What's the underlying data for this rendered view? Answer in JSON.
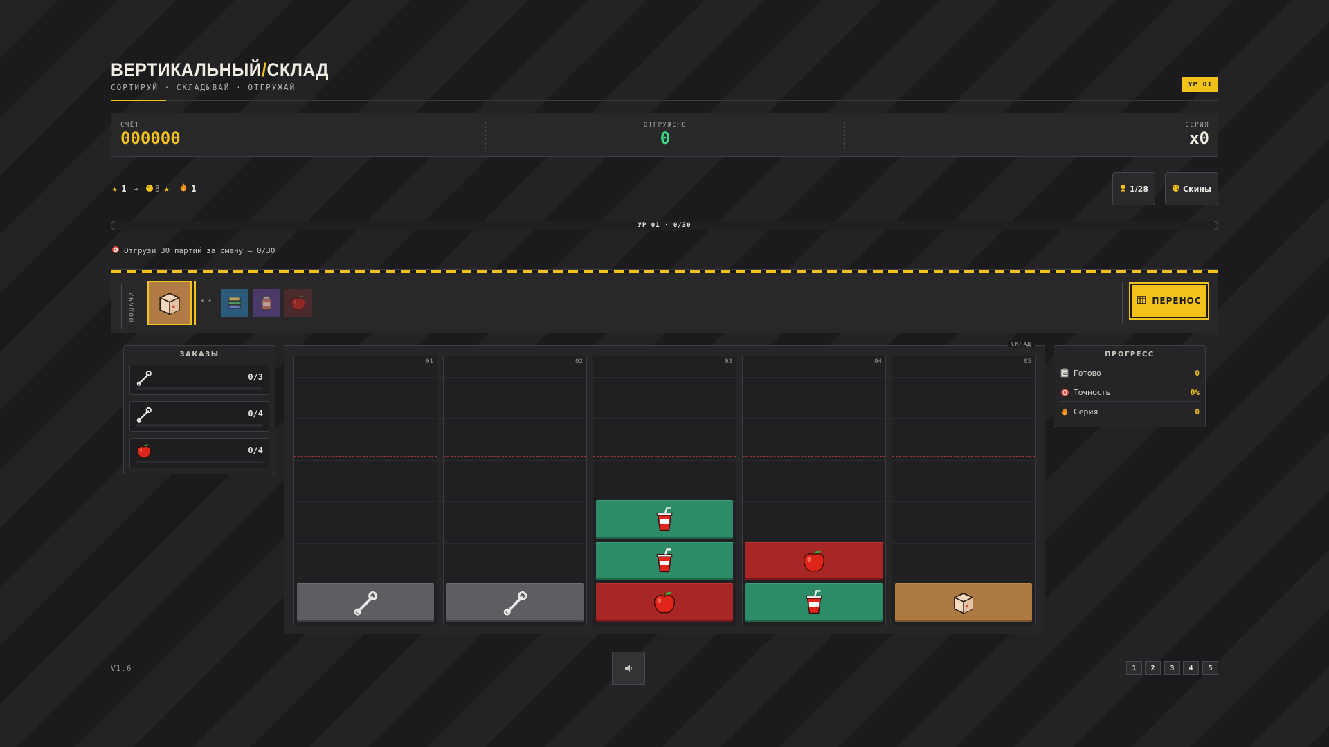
{
  "header": {
    "title_left": "ВЕРТИКАЛЬНЫЙ",
    "title_slash": "/",
    "title_right": "СКЛАД",
    "subtitle": "СОРТИРУЙ · СКЛАДЫВАЙ · ОТГРУЖАЙ",
    "level_badge": "УР 01"
  },
  "stats": {
    "score_label": "СЧЁТ",
    "score_value": "000000",
    "shipped_label": "ОТГРУЖЕНО",
    "shipped_value": "0",
    "streak_label": "СЕРИЯ",
    "streak_value": "x0"
  },
  "resources": {
    "stars": "1",
    "arrow": "→",
    "coins": "8",
    "flames": "1"
  },
  "buttons": {
    "trophies": "1/28",
    "skins": "Скины",
    "transfer": "ПЕРЕНОС"
  },
  "level_progress": {
    "label": "УР 01 · 0/30",
    "fraction": 0
  },
  "goal": {
    "text": "Отгрузи 30 партий за смену — 0/30"
  },
  "feed": {
    "label": "ПОДАЧА",
    "arrows": "◂ ◂",
    "current": "box-icon",
    "queue": [
      "books-icon",
      "jar-icon",
      "apple-icon"
    ]
  },
  "orders": {
    "title": "ЗАКАЗЫ",
    "items": [
      {
        "icon": "wrench-icon",
        "count": "0/3"
      },
      {
        "icon": "wrench-icon",
        "count": "0/4"
      },
      {
        "icon": "apple-icon",
        "count": "0/4"
      }
    ]
  },
  "warehouse": {
    "tag": "СКЛАД",
    "columns": [
      {
        "num": "01",
        "blocks": [
          "gray-wrench"
        ]
      },
      {
        "num": "02",
        "blocks": [
          "gray-wrench"
        ]
      },
      {
        "num": "03",
        "blocks": [
          "red-apple",
          "green-cup",
          "green-cup"
        ]
      },
      {
        "num": "04",
        "blocks": [
          "green-cup",
          "red-apple"
        ]
      },
      {
        "num": "05",
        "blocks": [
          "tan-box"
        ]
      }
    ]
  },
  "progress": {
    "title": "ПРОГРЕСС",
    "rows": [
      {
        "icon": "clipboard-icon",
        "label": "Готово",
        "value": "0"
      },
      {
        "icon": "target-icon",
        "label": "Точность",
        "value": "0%"
      },
      {
        "icon": "flame-icon",
        "label": "Серия",
        "value": "0"
      }
    ]
  },
  "footer": {
    "version": "V1.6",
    "levels": [
      "1",
      "2",
      "3",
      "4",
      "5"
    ]
  },
  "colors": {
    "accent": "#f2c21b",
    "green_value": "#3ddc84",
    "block_green": "#2e8b68",
    "block_red": "#a82626",
    "block_gray": "#5d5d62",
    "block_tan": "#ad7a44"
  }
}
